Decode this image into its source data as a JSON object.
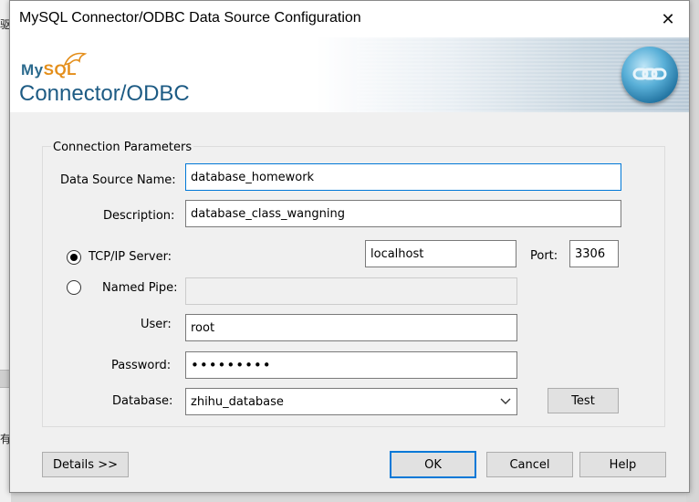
{
  "window": {
    "title": "MySQL Connector/ODBC Data Source Configuration",
    "close_label": "✕"
  },
  "banner": {
    "logo_my": "My",
    "logo_sql": "SQL",
    "product": "Connector/ODBC"
  },
  "group": {
    "legend": "Connection Parameters"
  },
  "fields": {
    "dsn_label": "Data Source Name:",
    "dsn_value": "database_homework",
    "description_label": "Description:",
    "description_value": "database_class_wangning",
    "tcp_label": "TCP/IP Server:",
    "server_value": "localhost",
    "port_label": "Port:",
    "port_value": "3306",
    "pipe_label": "Named Pipe:",
    "pipe_value": "",
    "user_label": "User:",
    "user_value": "root",
    "password_label": "Password:",
    "password_value": "•••••••••",
    "database_label": "Database:",
    "database_value": "zhihu_database"
  },
  "buttons": {
    "test": "Test",
    "details": "Details >>",
    "ok": "OK",
    "cancel": "Cancel",
    "help": "Help"
  },
  "connection_mode": "tcp",
  "background_app": {
    "glyph_top": "驱",
    "glyph_bottom": "有"
  }
}
